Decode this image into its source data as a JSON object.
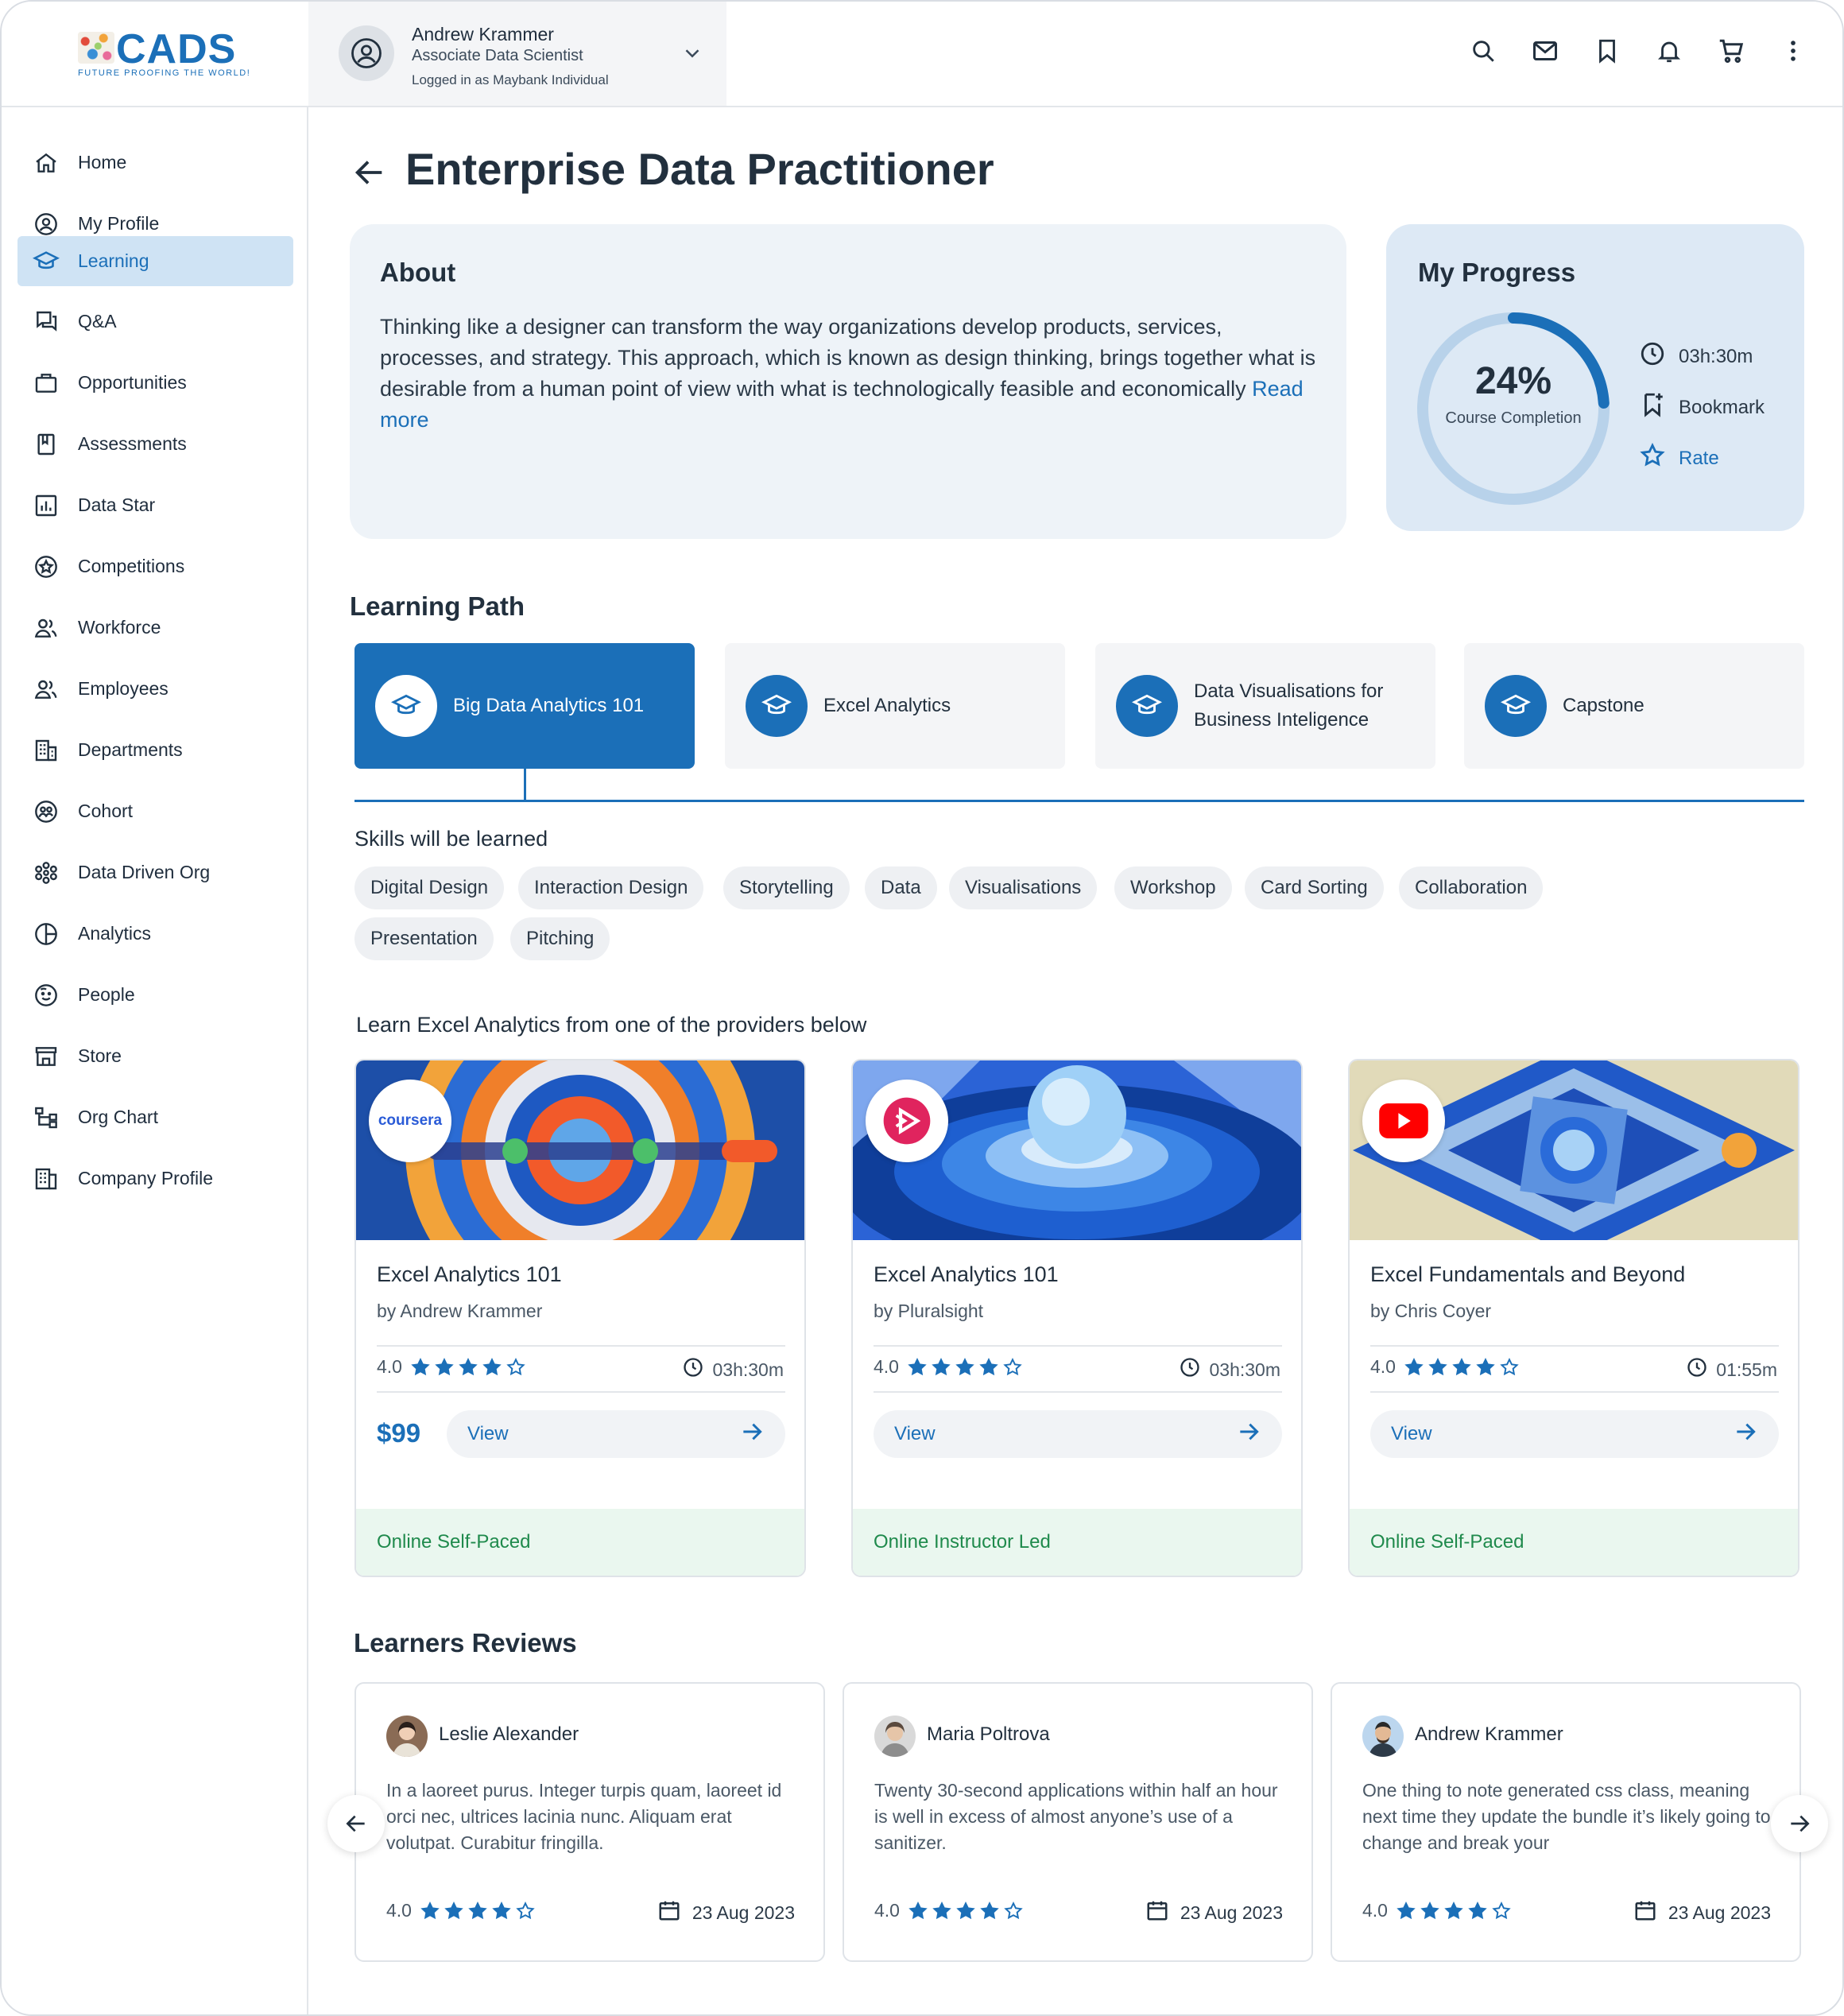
{
  "brand": {
    "logo_text": "CADS",
    "tagline": "FUTURE PROOFING THE WORLD!",
    "accent": "#1b6fb8"
  },
  "user": {
    "name": "Andrew Krammer",
    "role": "Associate Data Scientist",
    "login": "Logged in as Maybank Individual"
  },
  "top_icons": [
    "search-icon",
    "mail-icon",
    "bookmark-icon",
    "bell-icon",
    "cart-icon",
    "more-vertical-icon"
  ],
  "sidebar": {
    "items": [
      {
        "label": "Home",
        "icon": "home-icon"
      },
      {
        "label": "My Profile",
        "icon": "user-circle-icon"
      },
      {
        "label": "Learning",
        "icon": "graduation-cap-icon",
        "active": true
      },
      {
        "label": "Q&A",
        "icon": "chat-icon"
      },
      {
        "label": "Opportunities",
        "icon": "briefcase-icon"
      },
      {
        "label": "Assessments",
        "icon": "document-icon"
      },
      {
        "label": "Data Star",
        "icon": "bar-chart-icon"
      },
      {
        "label": "Competitions",
        "icon": "star-badge-icon"
      },
      {
        "label": "Workforce",
        "icon": "users-icon"
      },
      {
        "label": "Employees",
        "icon": "users-icon"
      },
      {
        "label": "Departments",
        "icon": "building-icon"
      },
      {
        "label": "Cohort",
        "icon": "group-icon"
      },
      {
        "label": "Data Driven Org",
        "icon": "network-icon"
      },
      {
        "label": "Analytics",
        "icon": "pie-chart-icon"
      },
      {
        "label": "People",
        "icon": "smile-icon"
      },
      {
        "label": "Store",
        "icon": "store-icon"
      },
      {
        "label": "Org Chart",
        "icon": "org-chart-icon"
      },
      {
        "label": "Company Profile",
        "icon": "company-icon"
      }
    ]
  },
  "page": {
    "title": "Enterprise Data Practitioner"
  },
  "about": {
    "heading": "About",
    "text": "Thinking like a designer can transform the way organizations develop products, services, processes, and strategy. This approach, which is known as design thinking, brings together what is desirable from a human point of view with what is technologically feasible and economically",
    "read_more": "Read more"
  },
  "progress": {
    "heading": "My Progress",
    "percent": 24,
    "percent_label": "24%",
    "completion_label": "Course Completion",
    "duration": "03h:30m",
    "bookmark": "Bookmark",
    "rate": "Rate"
  },
  "learning_path": {
    "heading": "Learning Path",
    "items": [
      {
        "label": "Big Data Analytics 101",
        "active": true
      },
      {
        "label": "Excel Analytics"
      },
      {
        "label": "Data Visualisations for Business Inteligence"
      },
      {
        "label": "Capstone"
      }
    ]
  },
  "skills": {
    "heading": "Skills will be learned",
    "items": [
      "Digital Design",
      "Interaction Design",
      "Storytelling",
      "Data",
      "Visualisations",
      "Workshop",
      "Card Sorting",
      "Collaboration",
      "Presentation",
      "Pitching"
    ]
  },
  "providers": {
    "heading": "Learn Excel Analytics from one of the providers below",
    "courses": [
      {
        "title": "Excel Analytics 101",
        "by": "by Andrew Krammer",
        "rating": "4.0",
        "stars": 4,
        "duration": "03h:30m",
        "price": "$99",
        "view": "View",
        "mode": "Online Self-Paced",
        "provider_badge": "coursera"
      },
      {
        "title": "Excel Analytics 101",
        "by": "by Pluralsight",
        "rating": "4.0",
        "stars": 4,
        "duration": "03h:30m",
        "price": "",
        "view": "View",
        "mode": "Online Instructor Led",
        "provider_badge": "pluralsight-icon"
      },
      {
        "title": "Excel Fundamentals and Beyond",
        "by": "by Chris Coyer",
        "rating": "4.0",
        "stars": 4,
        "duration": "01:55m",
        "price": "",
        "view": "View",
        "mode": "Online Self-Paced",
        "provider_badge": "youtube-icon"
      }
    ]
  },
  "reviews": {
    "heading": "Learners Reviews",
    "items": [
      {
        "name": "Leslie Alexander",
        "text": "In a laoreet purus. Integer turpis quam, laoreet id orci nec, ultrices lacinia nunc. Aliquam erat volutpat. Curabitur fringilla.",
        "rating": "4.0",
        "stars": 4,
        "date": "23 Aug 2023"
      },
      {
        "name": "Maria Poltrova",
        "text": "Twenty 30-second applications within half an hour is well in excess of almost anyone’s use of a sanitizer.",
        "rating": "4.0",
        "stars": 4,
        "date": "23 Aug 2023"
      },
      {
        "name": "Andrew Krammer",
        "text": "One thing to note generated css class, meaning next time they update the bundle it’s likely going to change and break your",
        "rating": "4.0",
        "stars": 4,
        "date": "23 Aug 2023"
      }
    ]
  }
}
